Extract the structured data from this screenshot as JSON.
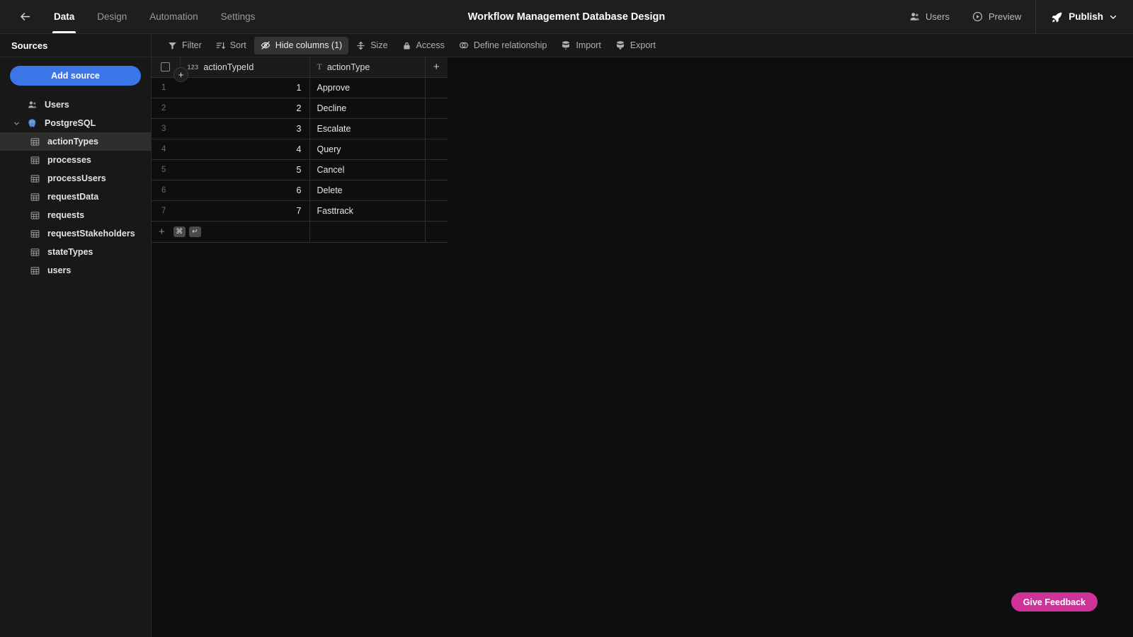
{
  "topbar": {
    "back_icon": "arrow-left-icon",
    "tabs": [
      {
        "label": "Data",
        "active": true
      },
      {
        "label": "Design",
        "active": false
      },
      {
        "label": "Automation",
        "active": false
      },
      {
        "label": "Settings",
        "active": false
      }
    ],
    "title": "Workflow Management Database Design",
    "actions": [
      {
        "label": "Users",
        "icon": "users-icon"
      },
      {
        "label": "Preview",
        "icon": "play-circle-icon"
      }
    ],
    "publish": {
      "label": "Publish",
      "icon": "rocket-icon",
      "chevron": "chevron-down-icon"
    }
  },
  "sidebar": {
    "heading": "Sources",
    "add_source_label": "Add source",
    "items": [
      {
        "label": "Users",
        "icon": "users-group-icon",
        "type": "source",
        "selected": false
      },
      {
        "label": "PostgreSQL",
        "icon": "postgresql-elephant-icon",
        "type": "database",
        "expanded": true,
        "selected": false
      },
      {
        "label": "actionTypes",
        "icon": "table-icon",
        "type": "table",
        "selected": true
      },
      {
        "label": "processes",
        "icon": "table-icon",
        "type": "table",
        "selected": false
      },
      {
        "label": "processUsers",
        "icon": "table-icon",
        "type": "table",
        "selected": false
      },
      {
        "label": "requestData",
        "icon": "table-icon",
        "type": "table",
        "selected": false
      },
      {
        "label": "requests",
        "icon": "table-icon",
        "type": "table",
        "selected": false
      },
      {
        "label": "requestStakeholders",
        "icon": "table-icon",
        "type": "table",
        "selected": false
      },
      {
        "label": "stateTypes",
        "icon": "table-icon",
        "type": "table",
        "selected": false
      },
      {
        "label": "users",
        "icon": "table-icon",
        "type": "table",
        "selected": false
      }
    ]
  },
  "toolbar": {
    "buttons": [
      {
        "label": "Filter",
        "icon": "funnel-icon",
        "active": false
      },
      {
        "label": "Sort",
        "icon": "sort-icon",
        "active": false
      },
      {
        "label": "Hide columns (1)",
        "icon": "eye-off-icon",
        "active": true
      },
      {
        "label": "Size",
        "icon": "row-height-icon",
        "active": false
      },
      {
        "label": "Access",
        "icon": "lock-icon",
        "active": false
      },
      {
        "label": "Define relationship",
        "icon": "relationship-icon",
        "active": false
      },
      {
        "label": "Import",
        "icon": "database-import-icon",
        "active": false
      },
      {
        "label": "Export",
        "icon": "database-export-icon",
        "active": false
      }
    ]
  },
  "grid": {
    "columns": [
      {
        "name": "actionTypeId",
        "type_icon": "number-123-icon",
        "align": "right"
      },
      {
        "name": "actionType",
        "type_icon": "text-T-icon",
        "align": "left"
      }
    ],
    "add_column_label": "+",
    "rows": [
      {
        "num": "1",
        "actionTypeId": "1",
        "actionType": "Approve"
      },
      {
        "num": "2",
        "actionTypeId": "2",
        "actionType": "Decline"
      },
      {
        "num": "3",
        "actionTypeId": "3",
        "actionType": "Escalate"
      },
      {
        "num": "4",
        "actionTypeId": "4",
        "actionType": "Query"
      },
      {
        "num": "5",
        "actionTypeId": "5",
        "actionType": "Cancel"
      },
      {
        "num": "6",
        "actionTypeId": "6",
        "actionType": "Delete"
      },
      {
        "num": "7",
        "actionTypeId": "7",
        "actionType": "Fasttrack"
      }
    ],
    "add_row": {
      "plus": "+",
      "shortcut_keys": [
        "⌘",
        "↵"
      ]
    },
    "float_add_label": "+"
  },
  "feedback": {
    "label": "Give Feedback"
  },
  "colors": {
    "accent_blue": "#3b76e8",
    "feedback_pink": "#cf339a",
    "topbar_bg": "#1e1e1e",
    "sidebar_bg": "#181818",
    "grid_bg": "#0e0e0e",
    "selected_row_bg": "#2e2e2e"
  }
}
